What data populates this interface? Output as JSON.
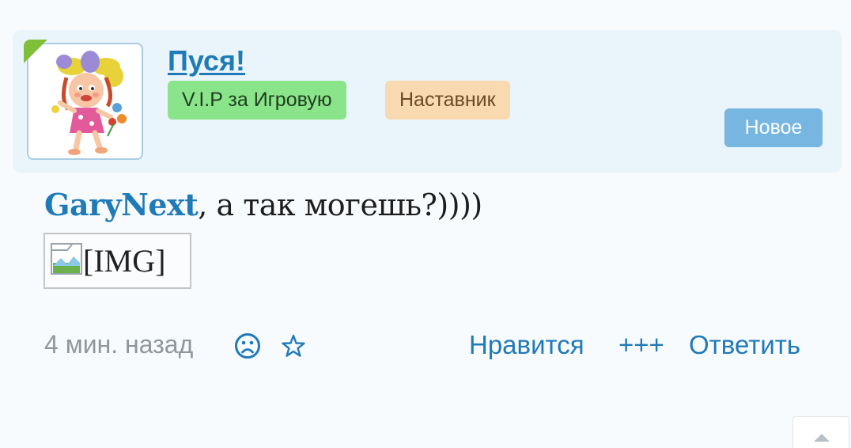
{
  "post": {
    "author": {
      "name": "Пуся!",
      "badges": [
        "V.I.P за Игровую",
        "Наставник"
      ]
    },
    "new_label": "Новое",
    "message": {
      "mention": "GaryNext",
      "text": ", а так могешь?))))"
    },
    "image": {
      "alt": "[IMG]"
    },
    "footer": {
      "time": "4 мин. назад",
      "icons": [
        "sad-face-icon",
        "star-icon"
      ],
      "like_label": "Нравится",
      "plus_label": "+++",
      "reply_label": "Ответить"
    }
  },
  "colors": {
    "link": "#1f7ab8",
    "header_bg": "#eaf4fb",
    "badge_vip": "#8ae48a",
    "badge_mentor": "#f9d9b0",
    "new_button": "#78b6e2",
    "muted_text": "#8f969c"
  }
}
